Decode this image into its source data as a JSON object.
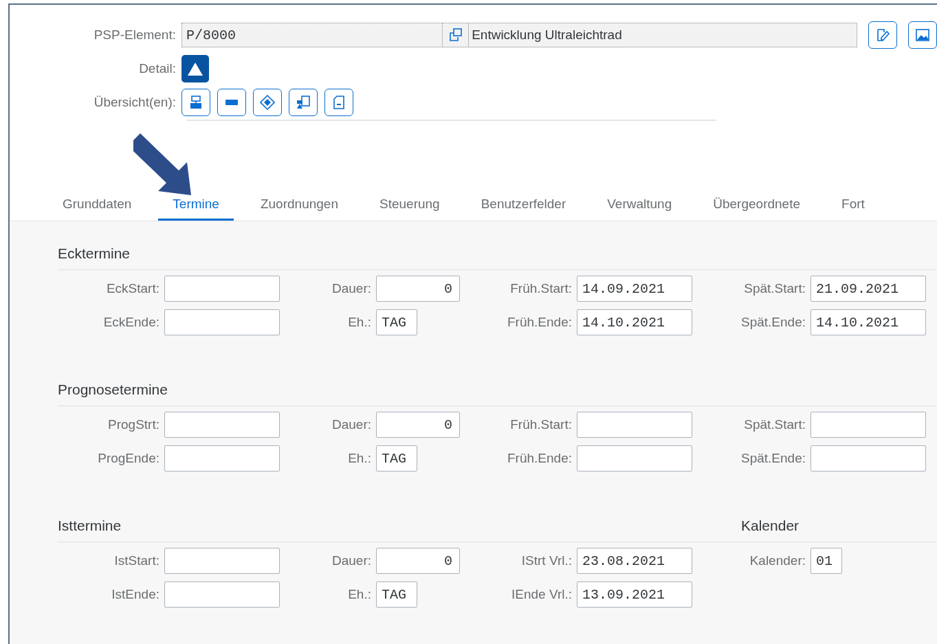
{
  "header": {
    "psp_label": "PSP-Element:",
    "psp_value": "P/8000",
    "description": "Entwicklung Ultraleichtrad",
    "detail_label": "Detail:",
    "overview_label": "Übersicht(en):"
  },
  "tabs": [
    {
      "label": "Grunddaten",
      "selected": false
    },
    {
      "label": "Termine",
      "selected": true
    },
    {
      "label": "Zuordnungen",
      "selected": false
    },
    {
      "label": "Steuerung",
      "selected": false
    },
    {
      "label": "Benutzerfelder",
      "selected": false
    },
    {
      "label": "Verwaltung",
      "selected": false
    },
    {
      "label": "Übergeordnete",
      "selected": false
    },
    {
      "label": "Fort",
      "selected": false
    }
  ],
  "sections": [
    {
      "title": "Ecktermine",
      "rows": [
        [
          {
            "label": "EckStart:",
            "kind": "date"
          },
          {
            "label": "Dauer:",
            "kind": "number",
            "value": "0"
          },
          {
            "label": "Früh.Start:",
            "kind": "date",
            "value": "14.09.2021"
          },
          {
            "label": "Spät.Start:",
            "kind": "date",
            "value": "21.09.2021"
          }
        ],
        [
          {
            "label": "EckEnde:",
            "kind": "date"
          },
          {
            "label": "Eh.:",
            "kind": "unit",
            "value": "TAG"
          },
          {
            "label": "Früh.Ende:",
            "kind": "date",
            "value": "14.10.2021"
          },
          {
            "label": "Spät.Ende:",
            "kind": "date",
            "value": "14.10.2021"
          }
        ]
      ]
    },
    {
      "title": "Prognosetermine",
      "rows": [
        [
          {
            "label": "ProgStrt:",
            "kind": "date"
          },
          {
            "label": "Dauer:",
            "kind": "number",
            "value": "0"
          },
          {
            "label": "Früh.Start:",
            "kind": "date"
          },
          {
            "label": "Spät.Start:",
            "kind": "date"
          }
        ],
        [
          {
            "label": "ProgEnde:",
            "kind": "date"
          },
          {
            "label": "Eh.:",
            "kind": "unit",
            "value": "TAG"
          },
          {
            "label": "Früh.Ende:",
            "kind": "date"
          },
          {
            "label": "Spät.Ende:",
            "kind": "date"
          }
        ]
      ]
    },
    {
      "title": "Isttermine",
      "aside_title": "Kalender",
      "rows": [
        [
          {
            "label": "IstStart:",
            "kind": "date"
          },
          {
            "label": "Dauer:",
            "kind": "number",
            "value": "0"
          },
          {
            "label": "IStrt Vrl.:",
            "kind": "date",
            "value": "23.08.2021"
          },
          {
            "label": "Kalender:",
            "kind": "short",
            "value": "01"
          }
        ],
        [
          {
            "label": "IstEnde:",
            "kind": "date"
          },
          {
            "label": "Eh.:",
            "kind": "unit",
            "value": "TAG"
          },
          {
            "label": "IEnde Vrl.:",
            "kind": "date",
            "value": "13.09.2021"
          }
        ]
      ]
    }
  ]
}
